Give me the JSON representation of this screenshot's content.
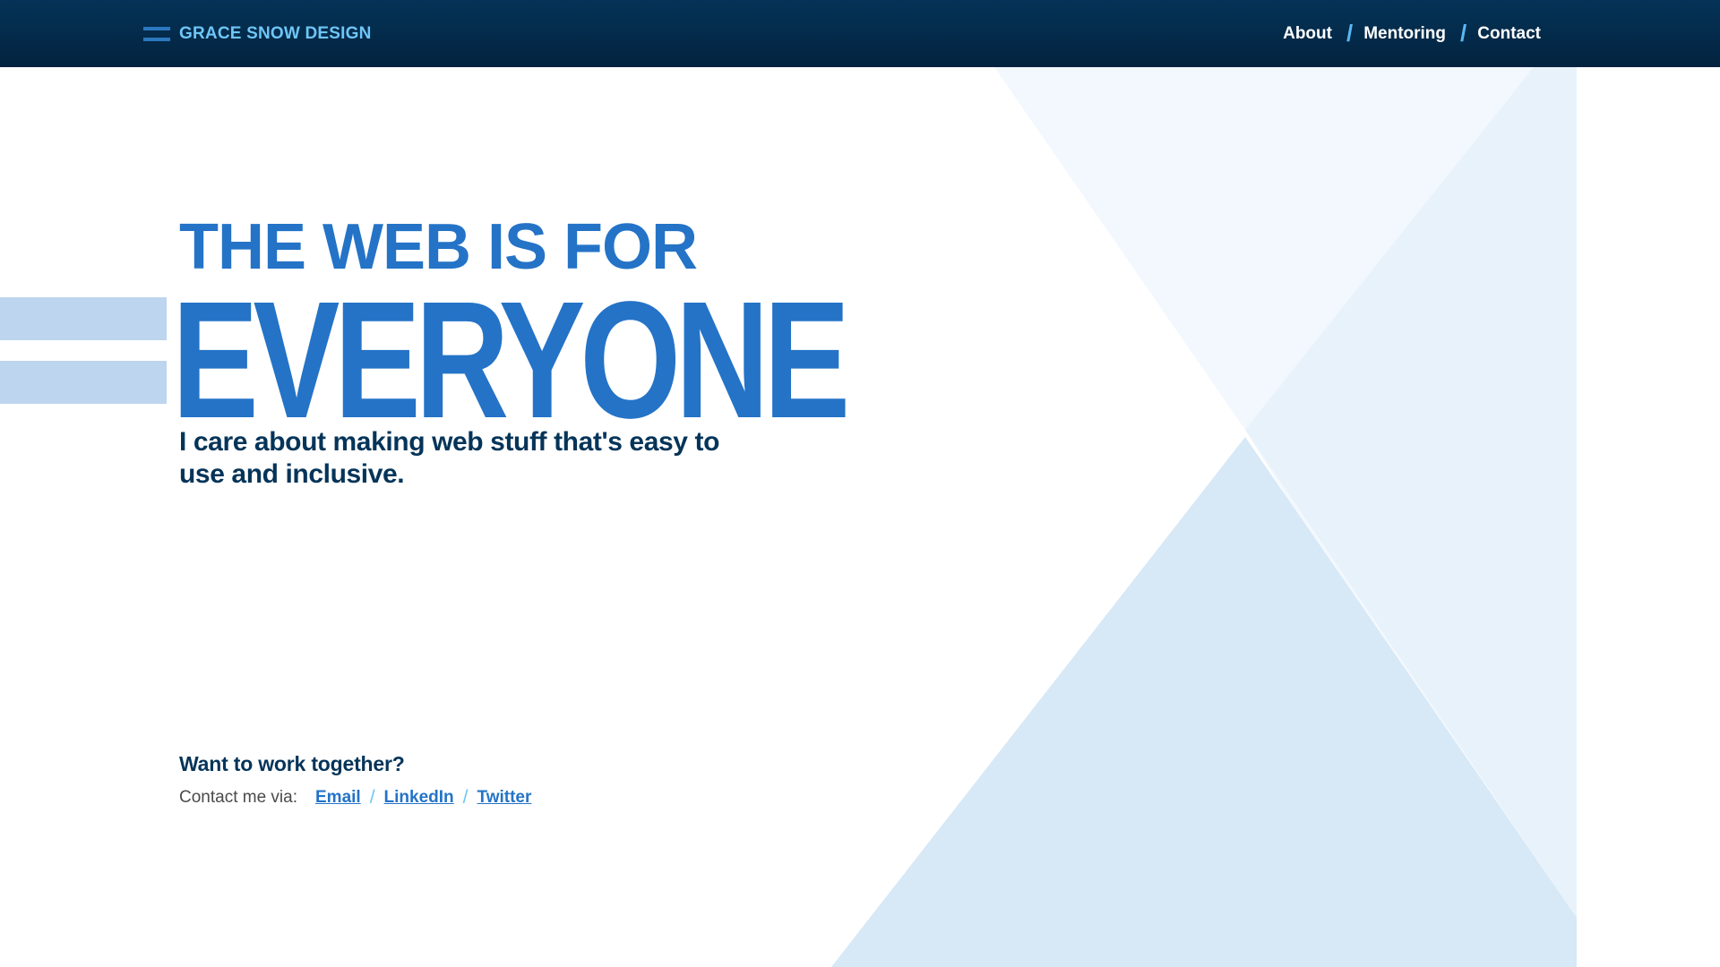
{
  "header": {
    "brand": "GRACE SNOW DESIGN",
    "menu_icon": "hamburger-menu-icon",
    "nav": [
      {
        "label": "About"
      },
      {
        "label": "Mentoring"
      },
      {
        "label": "Contact"
      }
    ],
    "separator": "/"
  },
  "hero": {
    "line1": "THE WEB IS FOR",
    "line2": "EVERYONE",
    "tagline": "I care about making web stuff that's easy to use and inclusive."
  },
  "contact": {
    "heading": "Want to work together?",
    "label": "Contact me via:",
    "links": [
      {
        "label": "Email"
      },
      {
        "label": "LinkedIn"
      },
      {
        "label": "Twitter"
      }
    ],
    "separator": "/"
  },
  "colors": {
    "header_bg": "#043357",
    "brand": "#6ec6f7",
    "accent_blue": "#2473c7",
    "dark_navy": "#053459",
    "light_bar": "#bdd5ee",
    "triangle_light": "#f2f8fd",
    "triangle_mid": "#e8f2fb",
    "triangle_dark": "#d7e8f6"
  }
}
